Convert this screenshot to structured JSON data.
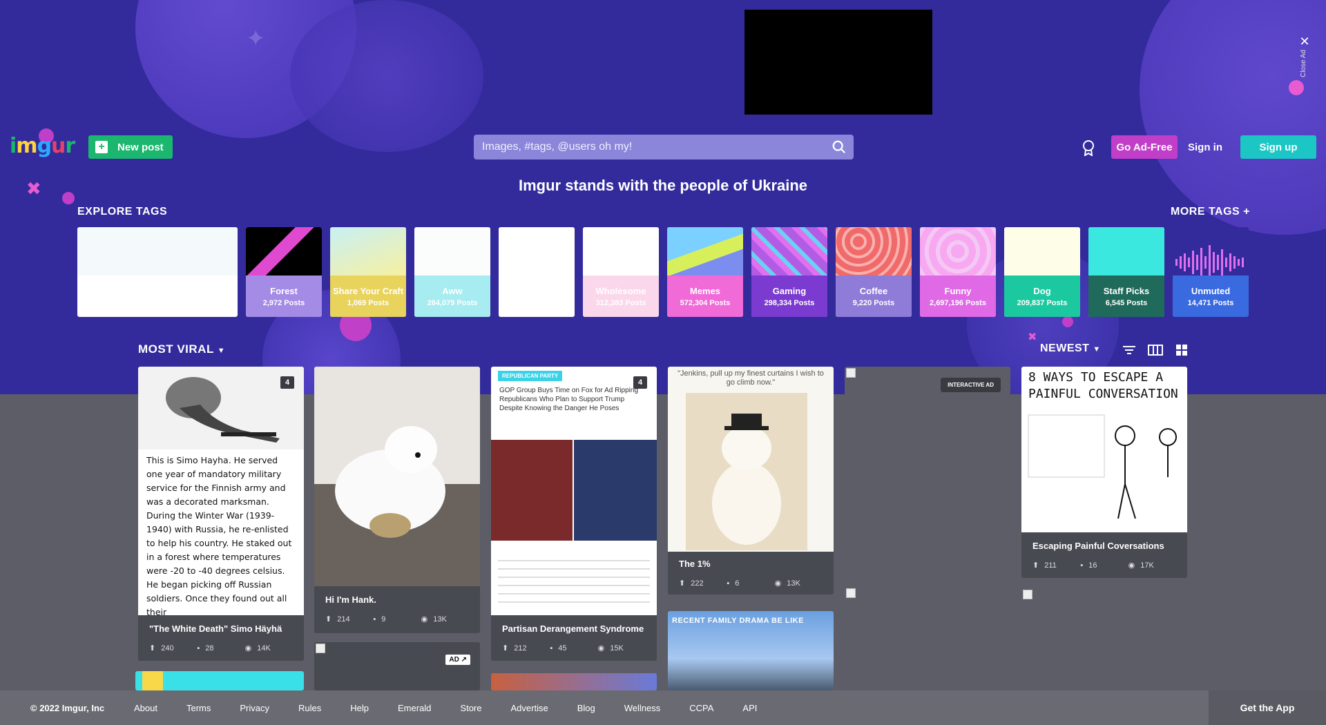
{
  "ad": {
    "close_label": "Close Ad",
    "close_glyph": "✕"
  },
  "header": {
    "logo": [
      "i",
      "m",
      "g",
      "u",
      "r"
    ],
    "new_post_label": "New post",
    "search_placeholder": "Images, #tags, @users oh my!",
    "go_adfree_label": "Go Ad-Free",
    "sign_in_label": "Sign in",
    "sign_up_label": "Sign up"
  },
  "banner": "Imgur stands with the people of Ukraine",
  "explore": {
    "heading": "EXPLORE TAGS",
    "more_label": "MORE TAGS +",
    "tags": [
      {
        "name": "",
        "posts": "",
        "color": "#eef7fb"
      },
      {
        "name": "Forest",
        "posts": "2,972 Posts",
        "color": "#a48be6"
      },
      {
        "name": "Share Your Craft",
        "posts": "1,069 Posts",
        "color": "#e8d35c"
      },
      {
        "name": "Aww",
        "posts": "264,079 Posts",
        "color": "#a6ecf0"
      },
      {
        "name": "",
        "posts": "",
        "color": "#ffffff"
      },
      {
        "name": "Wholesome",
        "posts": "312,383 Posts",
        "color": "#fbd7ec"
      },
      {
        "name": "Memes",
        "posts": "572,304 Posts",
        "color": "#f06ad8"
      },
      {
        "name": "Gaming",
        "posts": "298,334 Posts",
        "color": "#7b3ad0"
      },
      {
        "name": "Coffee",
        "posts": "9,220 Posts",
        "color": "#8e7cd8"
      },
      {
        "name": "Funny",
        "posts": "2,697,196 Posts",
        "color": "#e06ae6"
      },
      {
        "name": "Dog",
        "posts": "209,837 Posts",
        "color": "#1cc8a0"
      },
      {
        "name": "Staff Picks",
        "posts": "6,545 Posts",
        "color": "#1f6a5a"
      },
      {
        "name": "Unmuted",
        "posts": "14,471 Posts",
        "color": "#3a6ae0"
      }
    ]
  },
  "feed": {
    "sort_label": "MOST VIRAL",
    "order_label": "NEWEST",
    "posts": [
      {
        "title": "\"The White Death\" Simo Häyhä",
        "up": "240",
        "comments": "28",
        "views": "14K",
        "badge": "4",
        "body": "This is Simo Hayha. He served one year of mandatory military service for the Finnish army and was a decorated marksman. During the Winter War (1939-1940) with Russia, he re-enlisted to help his country. He staked out in a forest where temperatures were -20 to -40 degrees celsius. He began picking off Russian soldiers. Once they found out all their"
      },
      {
        "title": "Hi I'm Hank.",
        "up": "214",
        "comments": "9",
        "views": "13K"
      },
      {
        "title": "Partisan Derangement Syndrome",
        "up": "212",
        "comments": "45",
        "views": "15K",
        "badge": "4",
        "tag": "REPUBLICAN PARTY",
        "headline": "GOP Group Buys Time on Fox for Ad Ripping Republicans Who Plan to Support Trump Despite Knowing the Danger He Poses"
      },
      {
        "title": "The 1%",
        "up": "222",
        "comments": "6",
        "views": "13K",
        "caption": "\"Jenkins, pull up my finest curtains I wish to go climb now.\""
      },
      {
        "ad_label": "INTERACTIVE AD"
      },
      {
        "title": "Escaping Painful Coversations",
        "up": "211",
        "comments": "16",
        "views": "17K",
        "comic_title": "8 WAYS TO ESCAPE A PAINFUL CONVERSATION"
      },
      {
        "title": "",
        "caption": "RECENT FAMILY DRAMA BE LIKE"
      }
    ],
    "ad_badge": "AD ↗"
  },
  "footer": {
    "copyright": "© 2022 Imgur, Inc",
    "links": [
      "About",
      "Terms",
      "Privacy",
      "Rules",
      "Help",
      "Emerald",
      "Store",
      "Advertise",
      "Blog",
      "Wellness",
      "CCPA",
      "API"
    ],
    "get_app": "Get the App"
  }
}
